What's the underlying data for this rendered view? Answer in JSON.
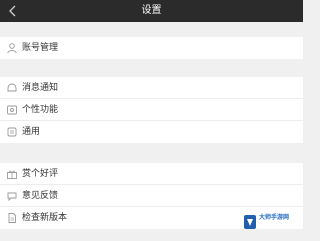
{
  "header": {
    "title": "设置",
    "back_icon": "chevron-left-icon"
  },
  "groups": [
    {
      "items": [
        {
          "label": "账号管理",
          "icon": "user-icon"
        }
      ]
    },
    {
      "items": [
        {
          "label": "消息通知",
          "icon": "bell-icon"
        },
        {
          "label": "个性功能",
          "icon": "personalize-icon"
        },
        {
          "label": "通用",
          "icon": "settings-icon"
        }
      ]
    },
    {
      "items": [
        {
          "label": "赏个好评",
          "icon": "gift-icon"
        },
        {
          "label": "意见反馈",
          "icon": "feedback-icon"
        },
        {
          "label": "检查新版本",
          "icon": "document-icon"
        }
      ]
    }
  ],
  "watermark": {
    "text": "大师手游网"
  },
  "colors": {
    "titlebar_bg": "#2b2b2b",
    "page_bg": "#f0f0f0",
    "row_bg": "#ffffff",
    "text": "#333333",
    "icon": "#9a9a9a"
  }
}
